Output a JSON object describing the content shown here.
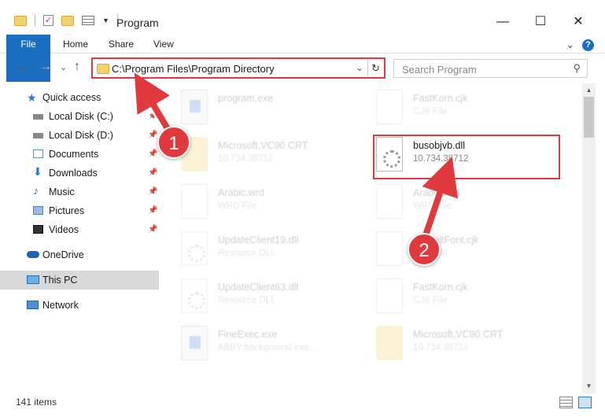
{
  "window": {
    "title": "Program",
    "minimize": "—",
    "maximize": "☐",
    "close": "✕"
  },
  "ribbon": {
    "tabs": [
      "File",
      "Home",
      "Share",
      "View"
    ],
    "expand": "⌄",
    "help": "?"
  },
  "nav": {
    "back": "←",
    "forward": "→",
    "recent": "⌄",
    "up": "↑"
  },
  "address": {
    "path": "C:\\Program Files\\Program Directory",
    "refresh": "↻"
  },
  "search": {
    "placeholder": "Search Program"
  },
  "sidebar": {
    "items": [
      {
        "label": "Quick access",
        "icon": "star-icon"
      },
      {
        "label": "Local Disk (C:)",
        "icon": "drive-icon",
        "pinned": true
      },
      {
        "label": "Local Disk (D:)",
        "icon": "drive-icon",
        "pinned": true
      },
      {
        "label": "Documents",
        "icon": "documents-icon",
        "pinned": true
      },
      {
        "label": "Downloads",
        "icon": "downloads-icon",
        "pinned": true
      },
      {
        "label": "Music",
        "icon": "music-icon",
        "pinned": true
      },
      {
        "label": "Pictures",
        "icon": "pictures-icon",
        "pinned": true
      },
      {
        "label": "Videos",
        "icon": "videos-icon",
        "pinned": true
      },
      {
        "label": "OneDrive",
        "icon": "cloud-icon"
      },
      {
        "label": "This PC",
        "icon": "computer-icon",
        "selected": true
      },
      {
        "label": "Network",
        "icon": "network-icon"
      }
    ]
  },
  "files": [
    {
      "name": "program.exe",
      "sub": "",
      "icon": "exe-icon",
      "faded": true
    },
    {
      "name": "FastKorn.cjk",
      "sub": "CJK File",
      "icon": "document-icon",
      "faded": true
    },
    {
      "name": "Microsoft.VC90.CRT",
      "sub": "10.734.38712",
      "icon": "folder-icon",
      "faded": true
    },
    {
      "name": "busobjvb.dll",
      "sub": "10.734.38712",
      "icon": "dll-gear-icon",
      "faded": false
    },
    {
      "name": "Arabic.wrd",
      "sub": "WRD File",
      "icon": "document-icon",
      "faded": true
    },
    {
      "name": "Arabic.wrd",
      "sub": "WRD File",
      "icon": "document-icon",
      "faded": true
    },
    {
      "name": "UpdateClient19.dll",
      "sub": "Resource DLL",
      "icon": "dll-gear-icon",
      "faded": true
    },
    {
      "name": "DefaultFont.cjk",
      "sub": "CJK File",
      "icon": "document-icon",
      "faded": true
    },
    {
      "name": "UpdateClient63.dll",
      "sub": "Resource DLL",
      "icon": "dll-gear-icon",
      "faded": true
    },
    {
      "name": "FastKorn.cjk",
      "sub": "CJK File",
      "icon": "document-icon",
      "faded": true
    },
    {
      "name": "FineExec.exe",
      "sub": "ABBY background exe...",
      "icon": "exe-icon",
      "faded": true
    },
    {
      "name": "Microsoft.VC90.CRT",
      "sub": "10.734.38712",
      "icon": "folder-icon",
      "faded": true
    }
  ],
  "annotations": {
    "step1": "1",
    "step2": "2"
  },
  "status": {
    "count": "141 items"
  },
  "colors": {
    "accent": "#1a6fc1",
    "highlight": "#e03a3e",
    "selected_nav": "#d9d9d9"
  }
}
